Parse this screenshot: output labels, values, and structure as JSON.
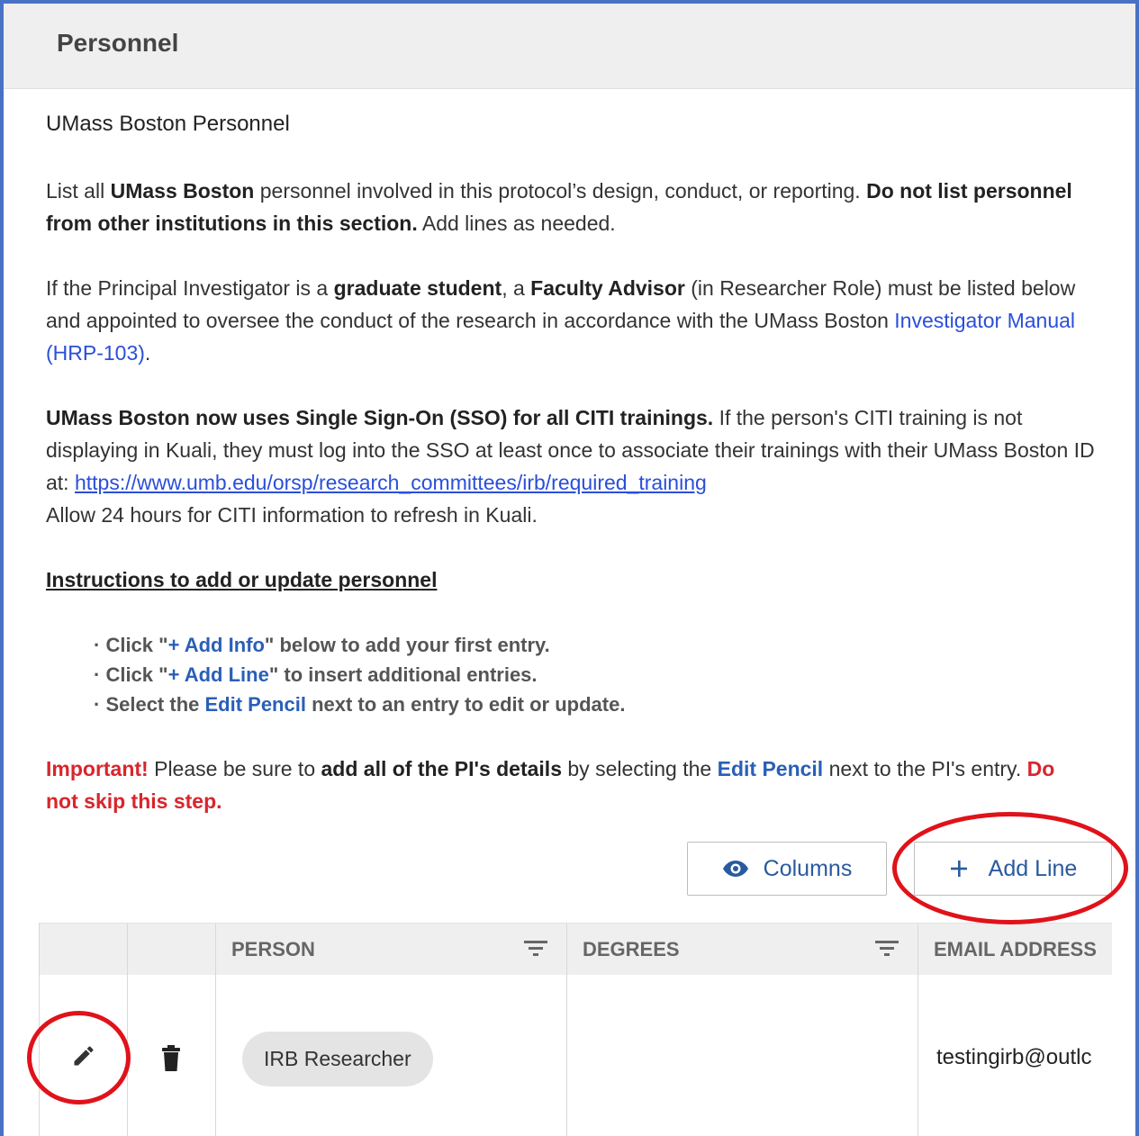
{
  "panel": {
    "title": "Personnel"
  },
  "section": {
    "title": "UMass Boston Personnel",
    "para1": {
      "t1": "List all ",
      "b1": "UMass Boston",
      "t2": " personnel involved in this protocol’s design, conduct, or reporting. ",
      "b2": "Do not list personnel from other institutions in this section.",
      "t3": " Add lines as needed."
    },
    "para2": {
      "t1": "If the Principal Investigator is a ",
      "b1": "graduate student",
      "t2": ", a ",
      "b2": "Faculty Advisor",
      "t3": " (in Researcher Role) must be listed below and appointed to oversee the conduct of the research in accordance with the UMass Boston ",
      "link": "Investigator Manual (HRP-103)",
      "t4": "."
    },
    "para3": {
      "b1": "UMass Boston now uses Single Sign-On (SSO) for all CITI trainings.",
      "t1": " If the person's CITI training is not displaying in Kuali, they must log into the SSO at least once to associate their trainings with their UMass Boston ID at: ",
      "url": "https://www.umb.edu/orsp/research_committees/irb/required_training",
      "t2": "Allow 24 hours for CITI information to refresh in Kuali."
    },
    "instructions_title": "Instructions to add or update personnel",
    "bullets": [
      {
        "pre": "· Click \"",
        "hl": "+ Add Info",
        "post": "\" below to add your first entry."
      },
      {
        "pre": "· Click \"",
        "hl": "+ Add Line",
        "post": "\" to insert additional entries."
      },
      {
        "pre": "· Select the ",
        "hl": "Edit Pencil",
        "post": " next to an entry to edit or update."
      }
    ],
    "important": {
      "r1": "Important!",
      "t1": " Please be sure to ",
      "b1": "add all of the PI's details",
      "t2": " by selecting the ",
      "hl": "Edit Pencil",
      "t3": " next to the PI's entry. ",
      "r2": "Do not skip this step."
    }
  },
  "toolbar": {
    "columns_label": "Columns",
    "add_line_label": "Add Line"
  },
  "table": {
    "columns": [
      "PERSON",
      "DEGREES",
      "EMAIL ADDRESS"
    ],
    "rows": [
      {
        "person": "IRB Researcher",
        "degrees": "",
        "email": "testingirb@outlc"
      }
    ]
  },
  "colors": {
    "accent": "#2a5fb8",
    "warning": "#d8262c",
    "annotation": "#e0121a",
    "frame": "#4a72c4"
  }
}
